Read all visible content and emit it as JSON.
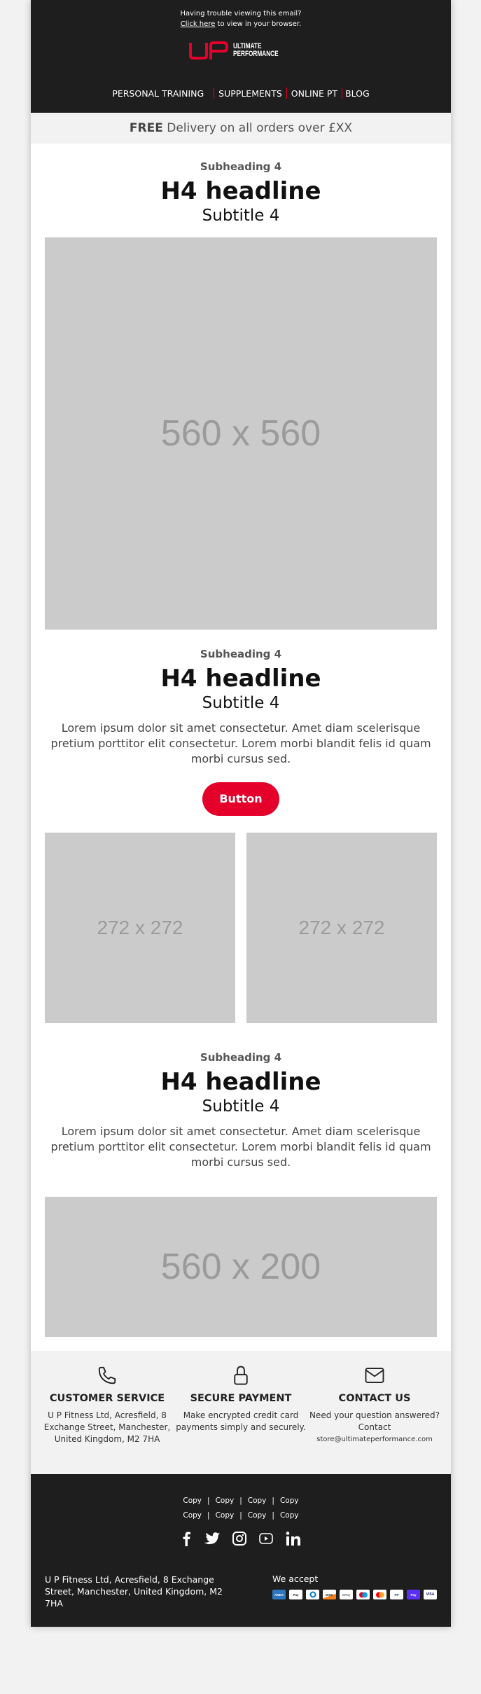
{
  "header": {
    "trouble_line": "Having trouble viewing this email?",
    "click_here": "Click here",
    "view_browser": " to view in your browser.",
    "logo": {
      "line1": "ULTIMATE",
      "line2": "PERFORMANCE",
      "mark": "UP"
    },
    "nav": [
      "PERSONAL TRAINING",
      "SUPPLEMENTS",
      "ONLINE PT",
      "BLOG"
    ]
  },
  "promo": {
    "bold": "FREE",
    "text": " Delivery on all orders over £XX"
  },
  "colors": {
    "brand_red": "#e4002b",
    "dark": "#1e1e1e",
    "placeholder": "#cbcbcb"
  },
  "sections": [
    {
      "subheading": "Subheading 4",
      "headline": "H4 headline",
      "subtitle": "Subtitle 4",
      "image": "560 x 560"
    },
    {
      "subheading": "Subheading 4",
      "headline": "H4 headline",
      "subtitle": "Subtitle 4",
      "body": "Lorem ipsum dolor sit amet consectetur. Amet diam scelerisque pretium porttitor elit consectetur. Lorem morbi blandit felis id quam morbi cursus sed.",
      "button": "Button",
      "images": [
        "272 x 272",
        "272 x 272"
      ]
    },
    {
      "subheading": "Subheading 4",
      "headline": "H4 headline",
      "subtitle": "Subtitle 4",
      "body": "Lorem ipsum dolor sit amet consectetur. Amet diam scelerisque pretium porttitor elit consectetur. Lorem morbi blandit felis id quam morbi cursus sed.",
      "image": "560 x 200"
    }
  ],
  "info": [
    {
      "icon": "phone-icon",
      "title": "CUSTOMER SERVICE",
      "text": "U P Fitness Ltd, Acresfield, 8 Exchange Street, Manchester, United Kingdom, M2 7HA"
    },
    {
      "icon": "lock-icon",
      "title": "SECURE PAYMENT",
      "text": "Make encrypted credit card payments simply and securely."
    },
    {
      "icon": "mail-icon",
      "title": "CONTACT US",
      "text": "Need your question answered? Contact",
      "email": "store@ultimateperformance.com"
    }
  ],
  "footer": {
    "links_row1": [
      "Copy",
      "Copy",
      "Copy",
      "Copy"
    ],
    "links_row2": [
      "Copy",
      "Copy",
      "Copy",
      "Copy"
    ],
    "social": [
      "facebook",
      "twitter",
      "instagram",
      "youtube",
      "linkedin"
    ],
    "address": "U P Fitness Ltd, Acresfield, 8 Exchange Street, Manchester, United Kingdom, M2 7HA",
    "we_accept": "We accept",
    "cards": [
      "AMEX",
      "Apple Pay",
      "Diners",
      "Discover",
      "G Pay",
      "Maestro",
      "Mastercard",
      "PayPal",
      "Shop Pay",
      "VISA"
    ]
  }
}
